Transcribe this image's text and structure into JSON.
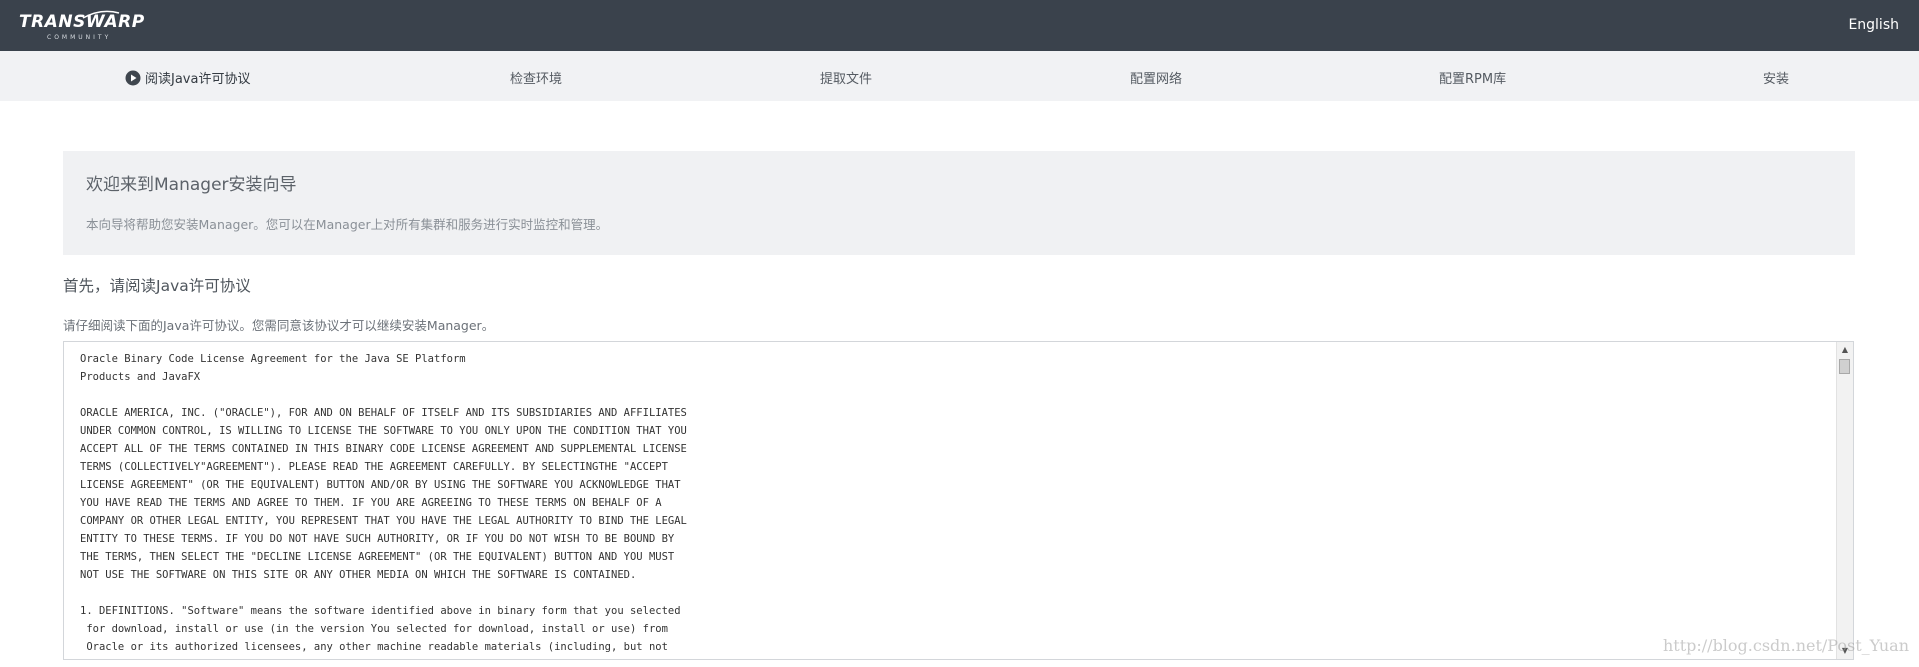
{
  "header": {
    "logo_text": "TRANSWARP",
    "logo_subtext": "COMMUNITY",
    "language": "English"
  },
  "steps": [
    {
      "label": "阅读Java许可协议",
      "active": true
    },
    {
      "label": "检查环境",
      "active": false
    },
    {
      "label": "提取文件",
      "active": false
    },
    {
      "label": "配置网络",
      "active": false
    },
    {
      "label": "配置RPM库",
      "active": false
    },
    {
      "label": "安装",
      "active": false
    }
  ],
  "welcome": {
    "title": "欢迎来到Manager安装向导",
    "description": "本向导将帮助您安装Manager。您可以在Manager上对所有集群和服务进行实时监控和管理。"
  },
  "section": {
    "title": "首先，请阅读Java许可协议",
    "description": "请仔细阅读下面的Java许可协议。您需同意该协议才可以继续安装Manager。"
  },
  "license_text": "Oracle Binary Code License Agreement for the Java SE Platform\nProducts and JavaFX\n\nORACLE AMERICA, INC. (\"ORACLE\"), FOR AND ON BEHALF OF ITSELF AND ITS SUBSIDIARIES AND AFFILIATES\nUNDER COMMON CONTROL, IS WILLING TO LICENSE THE SOFTWARE TO YOU ONLY UPON THE CONDITION THAT YOU\nACCEPT ALL OF THE TERMS CONTAINED IN THIS BINARY CODE LICENSE AGREEMENT AND SUPPLEMENTAL LICENSE\nTERMS (COLLECTIVELY\"AGREEMENT\"). PLEASE READ THE AGREEMENT CAREFULLY. BY SELECTINGTHE \"ACCEPT\nLICENSE AGREEMENT\" (OR THE EQUIVALENT) BUTTON AND/OR BY USING THE SOFTWARE YOU ACKNOWLEDGE THAT\nYOU HAVE READ THE TERMS AND AGREE TO THEM. IF YOU ARE AGREEING TO THESE TERMS ON BEHALF OF A\nCOMPANY OR OTHER LEGAL ENTITY, YOU REPRESENT THAT YOU HAVE THE LEGAL AUTHORITY TO BIND THE LEGAL\nENTITY TO THESE TERMS. IF YOU DO NOT HAVE SUCH AUTHORITY, OR IF YOU DO NOT WISH TO BE BOUND BY\nTHE TERMS, THEN SELECT THE \"DECLINE LICENSE AGREEMENT\" (OR THE EQUIVALENT) BUTTON AND YOU MUST\nNOT USE THE SOFTWARE ON THIS SITE OR ANY OTHER MEDIA ON WHICH THE SOFTWARE IS CONTAINED.\n\n1. DEFINITIONS. \"Software\" means the software identified above in binary form that you selected\n for download, install or use (in the version You selected for download, install or use) from\n Oracle or its authorized licensees, any other machine readable materials (including, but not",
  "watermark": "http://blog.csdn.net/Post_Yuan",
  "colors": {
    "topbar": "#3a424c",
    "steps_bar": "#f1f2f4",
    "welcome_bg": "#f0f1f3"
  },
  "icons": {
    "active_step": "play-circle-icon"
  }
}
